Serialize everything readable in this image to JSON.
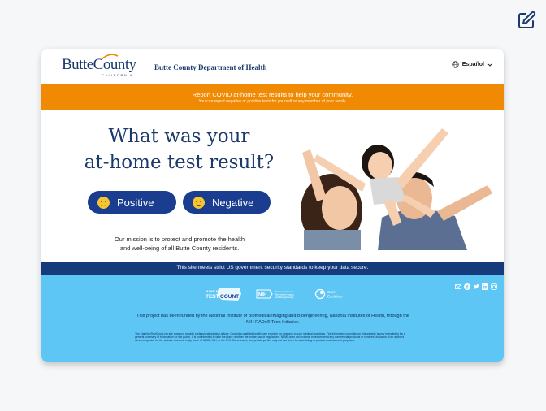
{
  "header": {
    "logo_text": "ButteCounty",
    "logo_sub": "CALIFORNIA",
    "department": "Butte County Department of Health",
    "language": "Español"
  },
  "banner": {
    "title": "Report COVID at-home test results to help your community.",
    "subtitle": "You can report negative or positive tests for yourself or any member of your family."
  },
  "hero": {
    "title_line1": "What was your",
    "title_line2": "at-home test result?",
    "positive_label": "Positive",
    "negative_label": "Negative",
    "mission_line1": "Our mission is to protect and promote the health",
    "mission_line2": "and well-being of all Butte County residents."
  },
  "security_text": "This site meets strict US government security standards to keep your data secure.",
  "footer": {
    "partner_logos": {
      "makemytestcount": "MAKE MY TEST COUNT",
      "nih": "National Institute of Biomedical Imaging and Bioengineering",
      "care_evolution": "Care Evolution"
    },
    "funding": "This project has been funded by the National Institute of Biomedical Imaging and Bioengineering, National Institutes of Health, through the NIH RADx® Tech Initiative.",
    "disclaimer": "The MakeMyTestCount.org site does not provide professional medical advice. Consult a qualified health care provider for answers to your medical questions. The information provided on this website is only intended to be a general summary of information for the public. It is not intended to take the place of either the written law or regulations. NIBIB does not endorse or recommend any commercial products or services. Inclusion of an author's views or opinion on the website does not imply these of NIBIB, NIH, or the U.S. Government, and private parties may not use them for advertising or product endorsement purposes."
  },
  "colors": {
    "navy": "#1b3a6b",
    "banner_orange": "#f18a03",
    "button_blue": "#1a3d8f",
    "footer_blue": "#5ec6f5"
  }
}
